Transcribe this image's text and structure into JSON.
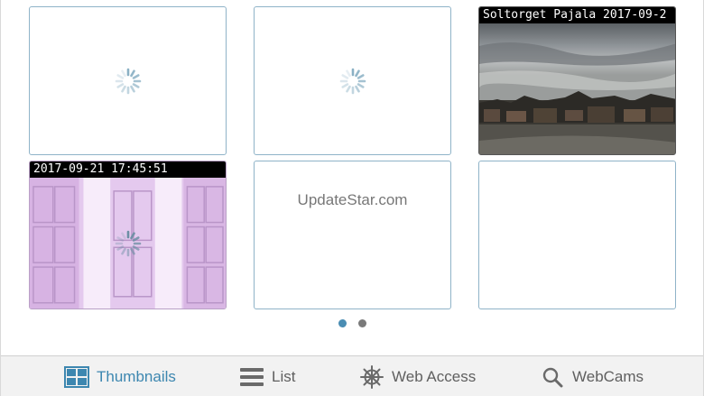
{
  "grid": {
    "tiles": [
      {
        "state": "loading"
      },
      {
        "state": "loading"
      },
      {
        "state": "image",
        "caption": "Soltorget Pajala 2017-09-2"
      },
      {
        "state": "image-loading",
        "caption": "2017-09-21 17:45:51"
      },
      {
        "state": "ad",
        "text": "UpdateStar.com"
      },
      {
        "state": "empty"
      }
    ]
  },
  "pager": {
    "pages": 2,
    "current": 1
  },
  "tabs": [
    {
      "label": "Thumbnails",
      "icon": "thumbnails-grid-icon",
      "active": true
    },
    {
      "label": "List",
      "icon": "list-icon",
      "active": false
    },
    {
      "label": "Web Access",
      "icon": "ship-wheel-icon",
      "active": false
    },
    {
      "label": "WebCams",
      "icon": "search-icon",
      "active": false
    }
  ],
  "colors": {
    "accent": "#3d87b0",
    "tile_border": "#8fb3c8",
    "tab_text": "#5f5f5f"
  }
}
